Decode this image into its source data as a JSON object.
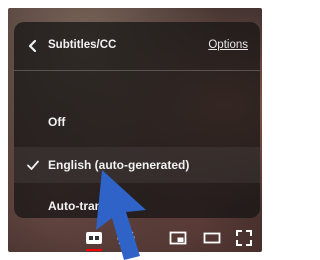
{
  "menu": {
    "title": "Subtitles/CC",
    "options_label": "Options",
    "items": [
      {
        "label": "Off",
        "selected": false
      },
      {
        "label": "English (auto-generated)",
        "selected": true
      },
      {
        "label": "Auto-translate",
        "selected": false
      }
    ]
  },
  "icons": {
    "back": "chevron-left-icon",
    "check": "check-icon",
    "captions": "captions-icon",
    "settings": "gear-icon",
    "miniplayer": "miniplayer-icon",
    "theater": "theater-mode-icon",
    "fullscreen": "fullscreen-icon",
    "cursor": "mouse-cursor-arrow"
  },
  "colors": {
    "accent": "#ff0000",
    "cursor": "#2f63c8",
    "text": "#f2f2f2"
  }
}
